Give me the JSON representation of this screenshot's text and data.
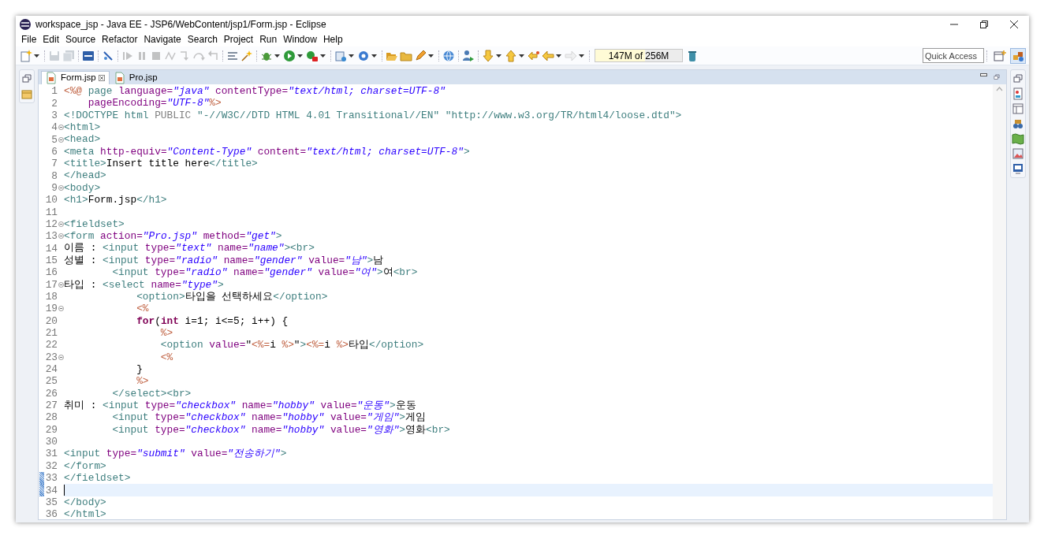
{
  "window": {
    "title": "workspace_jsp - Java EE - JSP6/WebContent/jsp1/Form.jsp - Eclipse"
  },
  "menu": [
    "File",
    "Edit",
    "Source",
    "Refactor",
    "Navigate",
    "Search",
    "Project",
    "Run",
    "Window",
    "Help"
  ],
  "toolbar": [
    {
      "kind": "new",
      "disabled": false,
      "dropdown": true
    },
    {
      "kind": "sep"
    },
    {
      "kind": "save",
      "disabled": true,
      "dropdown": false
    },
    {
      "kind": "saveall",
      "disabled": true,
      "dropdown": false
    },
    {
      "kind": "sep"
    },
    {
      "kind": "console",
      "disabled": false,
      "dropdown": false
    },
    {
      "kind": "sep"
    },
    {
      "kind": "skip",
      "disabled": false,
      "dropdown": false
    },
    {
      "kind": "sep"
    },
    {
      "kind": "resume",
      "disabled": true,
      "dropdown": false
    },
    {
      "kind": "suspend",
      "disabled": true,
      "dropdown": false
    },
    {
      "kind": "terminate",
      "disabled": true,
      "dropdown": false
    },
    {
      "kind": "disconnect",
      "disabled": true,
      "dropdown": false
    },
    {
      "kind": "stepinto",
      "disabled": true,
      "dropdown": false
    },
    {
      "kind": "stepover",
      "disabled": true,
      "dropdown": false
    },
    {
      "kind": "stepreturn",
      "disabled": true,
      "dropdown": false
    },
    {
      "kind": "sep"
    },
    {
      "kind": "mark",
      "disabled": false,
      "dropdown": false
    },
    {
      "kind": "wizard",
      "disabled": false,
      "dropdown": false
    },
    {
      "kind": "sep"
    },
    {
      "kind": "debug",
      "disabled": false,
      "dropdown": true
    },
    {
      "kind": "run",
      "disabled": false,
      "dropdown": true
    },
    {
      "kind": "ext",
      "disabled": false,
      "dropdown": true
    },
    {
      "kind": "sep"
    },
    {
      "kind": "server",
      "disabled": false,
      "dropdown": true
    },
    {
      "kind": "ring",
      "disabled": false,
      "dropdown": true
    },
    {
      "kind": "sep"
    },
    {
      "kind": "openfolder",
      "disabled": false,
      "dropdown": false
    },
    {
      "kind": "folder",
      "disabled": false,
      "dropdown": false
    },
    {
      "kind": "pen",
      "disabled": false,
      "dropdown": true
    },
    {
      "kind": "sep"
    },
    {
      "kind": "globe",
      "disabled": false,
      "dropdown": false
    },
    {
      "kind": "sep"
    },
    {
      "kind": "person",
      "disabled": false,
      "dropdown": false
    },
    {
      "kind": "sep"
    },
    {
      "kind": "down",
      "disabled": false,
      "dropdown": true
    },
    {
      "kind": "up",
      "disabled": false,
      "dropdown": true
    },
    {
      "kind": "lastedit",
      "disabled": false,
      "dropdown": false
    },
    {
      "kind": "back",
      "disabled": false,
      "dropdown": true
    },
    {
      "kind": "forward",
      "disabled": true,
      "dropdown": true
    },
    {
      "kind": "sep"
    }
  ],
  "heap": {
    "text": "147M of 256M",
    "level": 0.574
  },
  "quick_access": {
    "placeholder": "Quick Access"
  },
  "perspectives": [
    {
      "kind": "open",
      "selected": false
    },
    {
      "kind": "javaee",
      "selected": true
    }
  ],
  "tabs": [
    {
      "label": "Form.jsp",
      "selected": true,
      "closable": true
    },
    {
      "label": "Pro.jsp",
      "selected": false,
      "closable": false
    }
  ],
  "lines": [
    {
      "number": "1",
      "fold": false,
      "current": false,
      "changed": false,
      "tokens": [
        {
          "kind": "jsp",
          "text": "<%@"
        },
        {
          "kind": "tag",
          "text": " page"
        },
        {
          "kind": "attr",
          "text": " language="
        },
        {
          "kind": "value",
          "text": "\"java\""
        },
        {
          "kind": "attr",
          "text": " contentType="
        },
        {
          "kind": "value",
          "text": "\"text/html; charset=UTF-8\""
        }
      ]
    },
    {
      "number": "2",
      "fold": false,
      "current": false,
      "changed": false,
      "tokens": [
        {
          "kind": "attr",
          "text": "    pageEncoding="
        },
        {
          "kind": "value",
          "text": "\"UTF-8\""
        },
        {
          "kind": "jsp",
          "text": "%>"
        }
      ]
    },
    {
      "number": "3",
      "fold": false,
      "current": false,
      "changed": false,
      "tokens": [
        {
          "kind": "tag",
          "text": "<!DOCTYPE html"
        },
        {
          "kind": "doc",
          "text": " PUBLIC "
        },
        {
          "kind": "tag",
          "text": "\"-//W3C//DTD HTML 4.01 Transitional//EN\" \"http://www.w3.org/TR/html4/loose.dtd\">"
        }
      ]
    },
    {
      "number": "4",
      "fold": true,
      "current": false,
      "changed": false,
      "tokens": [
        {
          "kind": "tag",
          "text": "<html>"
        }
      ]
    },
    {
      "number": "5",
      "fold": true,
      "current": false,
      "changed": false,
      "tokens": [
        {
          "kind": "tag",
          "text": "<head>"
        }
      ]
    },
    {
      "number": "6",
      "fold": false,
      "current": false,
      "changed": false,
      "tokens": [
        {
          "kind": "tag",
          "text": "<meta"
        },
        {
          "kind": "attr",
          "text": " http-equiv="
        },
        {
          "kind": "value",
          "text": "\"Content-Type\""
        },
        {
          "kind": "attr",
          "text": " content="
        },
        {
          "kind": "value",
          "text": "\"text/html; charset=UTF-8\""
        },
        {
          "kind": "tag",
          "text": ">"
        }
      ]
    },
    {
      "number": "7",
      "fold": false,
      "current": false,
      "changed": false,
      "tokens": [
        {
          "kind": "tag",
          "text": "<title>"
        },
        {
          "kind": "text",
          "text": "Insert title here"
        },
        {
          "kind": "tag",
          "text": "</title>"
        }
      ]
    },
    {
      "number": "8",
      "fold": false,
      "current": false,
      "changed": false,
      "tokens": [
        {
          "kind": "tag",
          "text": "</head>"
        }
      ]
    },
    {
      "number": "9",
      "fold": true,
      "current": false,
      "changed": false,
      "tokens": [
        {
          "kind": "tag",
          "text": "<body>"
        }
      ]
    },
    {
      "number": "10",
      "fold": false,
      "current": false,
      "changed": false,
      "tokens": [
        {
          "kind": "tag",
          "text": "<h1>"
        },
        {
          "kind": "text",
          "text": "Form.jsp"
        },
        {
          "kind": "tag",
          "text": "</h1>"
        }
      ]
    },
    {
      "number": "11",
      "fold": false,
      "current": false,
      "changed": false
    },
    {
      "number": "12",
      "fold": true,
      "current": false,
      "changed": false,
      "tokens": [
        {
          "kind": "tag",
          "text": "<fieldset>"
        }
      ]
    },
    {
      "number": "13",
      "fold": true,
      "current": false,
      "changed": false,
      "tokens": [
        {
          "kind": "tag",
          "text": "<form"
        },
        {
          "kind": "attr",
          "text": " action="
        },
        {
          "kind": "value",
          "text": "\"Pro.jsp\""
        },
        {
          "kind": "attr",
          "text": " method="
        },
        {
          "kind": "value",
          "text": "\"get\""
        },
        {
          "kind": "tag",
          "text": ">"
        }
      ]
    },
    {
      "number": "14",
      "fold": false,
      "current": false,
      "changed": false,
      "tokens": [
        {
          "kind": "text",
          "text": "이름 : "
        },
        {
          "kind": "tag",
          "text": "<input"
        },
        {
          "kind": "attr",
          "text": " type="
        },
        {
          "kind": "value",
          "text": "\"text\""
        },
        {
          "kind": "attr",
          "text": " name="
        },
        {
          "kind": "value",
          "text": "\"name\""
        },
        {
          "kind": "tag",
          "text": "><br>"
        }
      ]
    },
    {
      "number": "15",
      "fold": false,
      "current": false,
      "changed": false,
      "tokens": [
        {
          "kind": "text",
          "text": "성별 : "
        },
        {
          "kind": "tag",
          "text": "<input"
        },
        {
          "kind": "attr",
          "text": " type="
        },
        {
          "kind": "value",
          "text": "\"radio\""
        },
        {
          "kind": "attr",
          "text": " name="
        },
        {
          "kind": "value",
          "text": "\"gender\""
        },
        {
          "kind": "attr",
          "text": " value="
        },
        {
          "kind": "value",
          "text": "\"남\""
        },
        {
          "kind": "tag",
          "text": ">"
        },
        {
          "kind": "text",
          "text": "남"
        }
      ]
    },
    {
      "number": "16",
      "fold": false,
      "current": false,
      "changed": false,
      "tokens": [
        {
          "kind": "tag",
          "text": "        <input"
        },
        {
          "kind": "attr",
          "text": " type="
        },
        {
          "kind": "value",
          "text": "\"radio\""
        },
        {
          "kind": "attr",
          "text": " name="
        },
        {
          "kind": "value",
          "text": "\"gender\""
        },
        {
          "kind": "attr",
          "text": " value="
        },
        {
          "kind": "value",
          "text": "\"여\""
        },
        {
          "kind": "tag",
          "text": ">"
        },
        {
          "kind": "text",
          "text": "여"
        },
        {
          "kind": "tag",
          "text": "<br>"
        }
      ]
    },
    {
      "number": "17",
      "fold": true,
      "current": false,
      "changed": false,
      "tokens": [
        {
          "kind": "text",
          "text": "타입 : "
        },
        {
          "kind": "tag",
          "text": "<select"
        },
        {
          "kind": "attr",
          "text": " name="
        },
        {
          "kind": "value",
          "text": "\"type\""
        },
        {
          "kind": "tag",
          "text": ">"
        }
      ]
    },
    {
      "number": "18",
      "fold": false,
      "current": false,
      "changed": false,
      "tokens": [
        {
          "kind": "tag",
          "text": "            <option>"
        },
        {
          "kind": "text",
          "text": "타입을 선택하세요"
        },
        {
          "kind": "tag",
          "text": "</option>"
        }
      ]
    },
    {
      "number": "19",
      "fold": true,
      "current": false,
      "changed": false,
      "tokens": [
        {
          "kind": "jsp",
          "text": "            <%"
        }
      ]
    },
    {
      "number": "20",
      "fold": false,
      "current": false,
      "changed": false,
      "tokens": [
        {
          "kind": "keyword",
          "text": "            for"
        },
        {
          "kind": "code",
          "text": "("
        },
        {
          "kind": "keyword",
          "text": "int"
        },
        {
          "kind": "code",
          "text": " i=1; i<=5; i++) {"
        }
      ]
    },
    {
      "number": "21",
      "fold": false,
      "current": false,
      "changed": false,
      "tokens": [
        {
          "kind": "jsp",
          "text": "                %>"
        }
      ]
    },
    {
      "number": "22",
      "fold": false,
      "current": false,
      "changed": false,
      "tokens": [
        {
          "kind": "tag",
          "text": "                <option"
        },
        {
          "kind": "attr",
          "text": " value="
        },
        {
          "kind": "code",
          "text": "\""
        },
        {
          "kind": "jsp",
          "text": "<%="
        },
        {
          "kind": "code",
          "text": "i "
        },
        {
          "kind": "jsp",
          "text": "%>"
        },
        {
          "kind": "code",
          "text": "\""
        },
        {
          "kind": "tag",
          "text": ">"
        },
        {
          "kind": "jsp",
          "text": "<%="
        },
        {
          "kind": "code",
          "text": "i "
        },
        {
          "kind": "jsp",
          "text": "%>"
        },
        {
          "kind": "text",
          "text": "타입"
        },
        {
          "kind": "tag",
          "text": "</option>"
        }
      ]
    },
    {
      "number": "23",
      "fold": true,
      "current": false,
      "changed": false,
      "tokens": [
        {
          "kind": "jsp",
          "text": "                <%"
        }
      ]
    },
    {
      "number": "24",
      "fold": false,
      "current": false,
      "changed": false,
      "tokens": [
        {
          "kind": "code",
          "text": "            }"
        }
      ]
    },
    {
      "number": "25",
      "fold": false,
      "current": false,
      "changed": false,
      "tokens": [
        {
          "kind": "jsp",
          "text": "            %>"
        }
      ]
    },
    {
      "number": "26",
      "fold": false,
      "current": false,
      "changed": false,
      "tokens": [
        {
          "kind": "tag",
          "text": "        </select><br>"
        }
      ]
    },
    {
      "number": "27",
      "fold": false,
      "current": false,
      "changed": false,
      "tokens": [
        {
          "kind": "text",
          "text": "취미 : "
        },
        {
          "kind": "tag",
          "text": "<input"
        },
        {
          "kind": "attr",
          "text": " type="
        },
        {
          "kind": "value",
          "text": "\"checkbox\""
        },
        {
          "kind": "attr",
          "text": " name="
        },
        {
          "kind": "value",
          "text": "\"hobby\""
        },
        {
          "kind": "attr",
          "text": " value="
        },
        {
          "kind": "value",
          "text": "\"운동\""
        },
        {
          "kind": "tag",
          "text": ">"
        },
        {
          "kind": "text",
          "text": "운동"
        }
      ]
    },
    {
      "number": "28",
      "fold": false,
      "current": false,
      "changed": false,
      "tokens": [
        {
          "kind": "tag",
          "text": "        <input"
        },
        {
          "kind": "attr",
          "text": " type="
        },
        {
          "kind": "value",
          "text": "\"checkbox\""
        },
        {
          "kind": "attr",
          "text": " name="
        },
        {
          "kind": "value",
          "text": "\"hobby\""
        },
        {
          "kind": "attr",
          "text": " value="
        },
        {
          "kind": "value",
          "text": "\"게임\""
        },
        {
          "kind": "tag",
          "text": ">"
        },
        {
          "kind": "text",
          "text": "게임"
        }
      ]
    },
    {
      "number": "29",
      "fold": false,
      "current": false,
      "changed": false,
      "tokens": [
        {
          "kind": "tag",
          "text": "        <input"
        },
        {
          "kind": "attr",
          "text": " type="
        },
        {
          "kind": "value",
          "text": "\"checkbox\""
        },
        {
          "kind": "attr",
          "text": " name="
        },
        {
          "kind": "value",
          "text": "\"hobby\""
        },
        {
          "kind": "attr",
          "text": " value="
        },
        {
          "kind": "value",
          "text": "\"영화\""
        },
        {
          "kind": "tag",
          "text": ">"
        },
        {
          "kind": "text",
          "text": "영화"
        },
        {
          "kind": "tag",
          "text": "<br>"
        }
      ]
    },
    {
      "number": "30",
      "fold": false,
      "current": false,
      "changed": false
    },
    {
      "number": "31",
      "fold": false,
      "current": false,
      "changed": false,
      "tokens": [
        {
          "kind": "tag",
          "text": "<input"
        },
        {
          "kind": "attr",
          "text": " type="
        },
        {
          "kind": "value",
          "text": "\"submit\""
        },
        {
          "kind": "attr",
          "text": " value="
        },
        {
          "kind": "value",
          "text": "\"전송하기\""
        },
        {
          "kind": "tag",
          "text": ">"
        }
      ]
    },
    {
      "number": "32",
      "fold": false,
      "current": false,
      "changed": false,
      "tokens": [
        {
          "kind": "tag",
          "text": "</form>"
        }
      ]
    },
    {
      "number": "33",
      "fold": false,
      "current": false,
      "changed": true,
      "tokens": [
        {
          "kind": "tag",
          "text": "</fieldset>"
        }
      ]
    },
    {
      "number": "34",
      "fold": false,
      "current": true,
      "changed": true
    },
    {
      "number": "35",
      "fold": false,
      "current": false,
      "changed": false,
      "tokens": [
        {
          "kind": "tag",
          "text": "</body>"
        }
      ]
    },
    {
      "number": "36",
      "fold": false,
      "current": false,
      "changed": false,
      "tokens": [
        {
          "kind": "tag",
          "text": "</html>"
        }
      ]
    }
  ]
}
